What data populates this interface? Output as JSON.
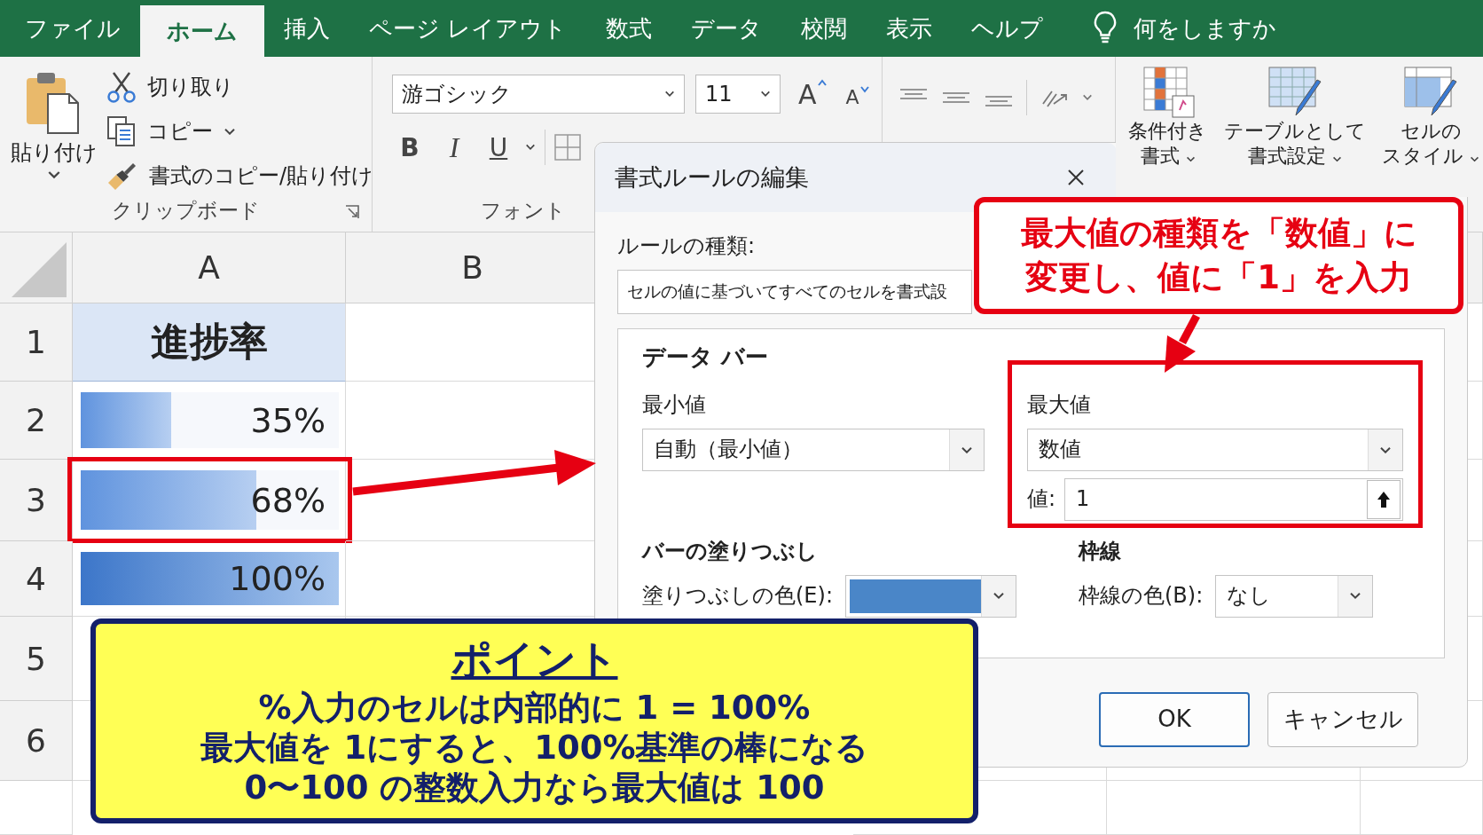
{
  "menu_tabs": [
    {
      "label": "ファイル",
      "selected": false
    },
    {
      "label": "ホーム",
      "selected": true
    },
    {
      "label": "挿入",
      "selected": false
    },
    {
      "label": "ページ レイアウト",
      "selected": false
    },
    {
      "label": "数式",
      "selected": false
    },
    {
      "label": "データ",
      "selected": false
    },
    {
      "label": "校閲",
      "selected": false
    },
    {
      "label": "表示",
      "selected": false
    },
    {
      "label": "ヘルプ",
      "selected": false
    }
  ],
  "tell_me": {
    "placeholder": "何をしますか"
  },
  "ribbon": {
    "clipboard": {
      "paste": "貼り付け",
      "cut": "切り取り",
      "copy": "コピー",
      "format_painter": "書式のコピー/貼り付け",
      "group_label": "クリップボード"
    },
    "font": {
      "font_name": "游ゴシック",
      "font_size": "11",
      "grow": "A",
      "shrink": "A",
      "bold": "B",
      "italic": "I",
      "underline": "U",
      "group_label": "フォント"
    },
    "styles": [
      {
        "lines": [
          "条件付き",
          "書式"
        ]
      },
      {
        "lines": [
          "テーブルとして",
          "書式設定"
        ]
      },
      {
        "lines": [
          "セルの",
          "スタイル"
        ]
      }
    ]
  },
  "sheet": {
    "columns": [
      "A",
      "B"
    ],
    "row_numbers": [
      "1",
      "2",
      "3",
      "4",
      "5",
      "6"
    ],
    "header_cell": "進捗率",
    "bars": [
      {
        "text": "35%",
        "level": 0.35,
        "highlighted": false
      },
      {
        "text": "68%",
        "level": 0.68,
        "highlighted": true
      },
      {
        "text": "100%",
        "level": 1,
        "highlighted": false
      }
    ]
  },
  "dialog": {
    "title": "書式ルールの編集",
    "rule_type_label": "ルールの種類:",
    "rule_type_value": "セルの値に基づいてすべてのセルを書式設",
    "section_title": "データ バー",
    "minimum": {
      "label": "最小値",
      "type": "自動（最小値）"
    },
    "maximum": {
      "label": "最大値",
      "type": "数値",
      "value_label": "値:",
      "value": "1",
      "highlighted": true
    },
    "fill_section": "バーの塗りつぶし",
    "fill": {
      "label": "塗りつぶしの色(E):",
      "color": "#4a86c8"
    },
    "border_section": "枠線",
    "border_color_label": "枠線の色(B):",
    "border_color": "なし",
    "buttons": [
      {
        "label": "OK",
        "default": true
      },
      {
        "label": "キャンセル",
        "default": false
      }
    ]
  },
  "callout": {
    "lines": [
      "最大値の種類を「数値」に",
      "変更し、値に「1」を入力"
    ]
  },
  "point": {
    "title": "ポイント",
    "lines": [
      "%入力のセルは内部的に 1 = 100%",
      "最大値を 1にすると、100%基準の棒になる",
      "0〜100 の整数入力なら最大値は 100"
    ]
  }
}
